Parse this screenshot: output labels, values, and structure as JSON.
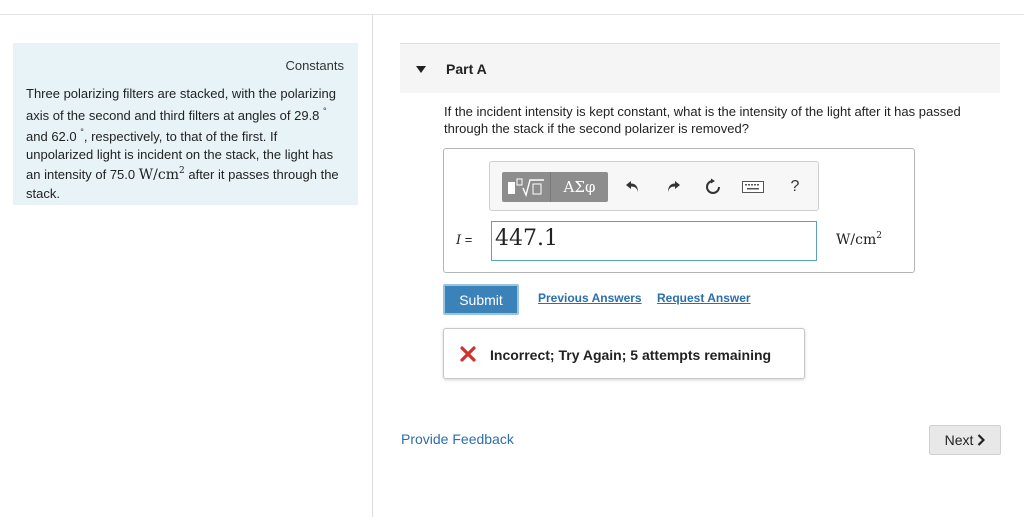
{
  "constants": {
    "title": "Constants",
    "problem": {
      "p1": "Three polarizing filters are stacked, with the polarizing axis of the second and third filters at angles of ",
      "angle1": "29.8",
      "deg": "°",
      "p2": " and ",
      "angle2": "62.0",
      "p3": ", respectively, to that of the first. If unpolarized light is incident on the stack, the light has an intensity of ",
      "intensity": "75.0",
      "unit_base": "W/cm",
      "unit_exp": "2",
      "p4": " after it passes through the stack."
    }
  },
  "part": {
    "title": "Part A",
    "question": "If the incident intensity is kept constant, what is the intensity of the light after it has passed through the stack if the second polarizer is removed?"
  },
  "toolbar": {
    "greek_label": "ΑΣφ",
    "help_label": "?"
  },
  "answer": {
    "variable": "I",
    "equals": " =",
    "value": "447.1",
    "unit_base": "W/cm",
    "unit_exp": "2"
  },
  "actions": {
    "submit": "Submit",
    "previous_answers": "Previous Answers",
    "request_answer": "Request Answer"
  },
  "feedback": {
    "message": "Incorrect; Try Again; 5 attempts remaining"
  },
  "footer": {
    "provide_feedback": "Provide Feedback",
    "next": "Next"
  },
  "colors": {
    "accent": "#3a82b8",
    "link": "#2a6fae",
    "error": "#d0312d",
    "panel": "#e8f3f7"
  }
}
